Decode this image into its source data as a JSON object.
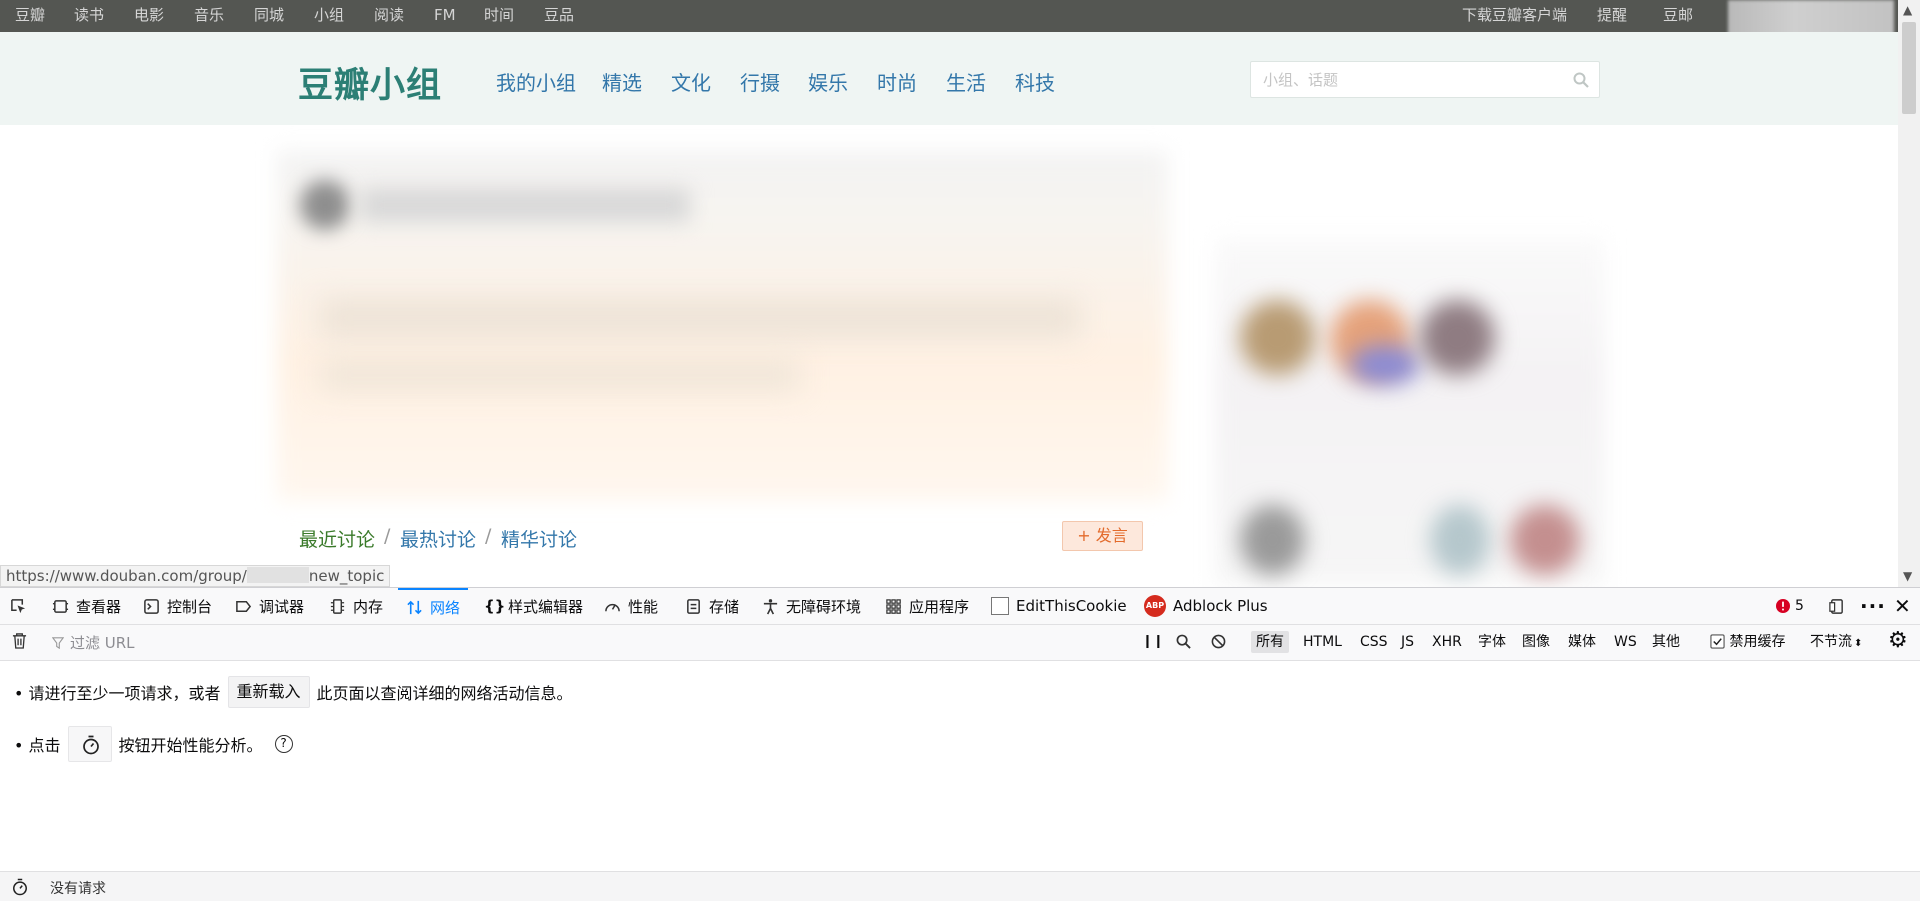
{
  "topnav": {
    "items": [
      "豆瓣",
      "读书",
      "电影",
      "音乐",
      "同城",
      "小组",
      "阅读",
      "FM",
      "时间",
      "豆品"
    ],
    "right": [
      "下载豆瓣客户端",
      "提醒",
      "豆邮"
    ]
  },
  "header": {
    "logo": "豆瓣小组",
    "nav": [
      "我的小组",
      "精选",
      "文化",
      "行摄",
      "娱乐",
      "时尚",
      "生活",
      "科技"
    ],
    "search_placeholder": "小组、话题"
  },
  "discussion_tabs": {
    "items": [
      "最近讨论",
      "最热讨论",
      "精华讨论"
    ],
    "separator": "/",
    "post_button": "+ 发言"
  },
  "status_url": {
    "prefix": "https://www.douban.com/group/",
    "suffix": "new_topic"
  },
  "devtools": {
    "tabs": [
      "查看器",
      "控制台",
      "调试器",
      "内存",
      "网络",
      "样式编辑器",
      "性能",
      "存储",
      "无障碍环境",
      "应用程序",
      "EditThisCookie",
      "Adblock Plus"
    ],
    "active_tab": "网络",
    "error_count": "5",
    "filter_placeholder": "过滤 URL",
    "type_filters": [
      "所有",
      "HTML",
      "CSS",
      "JS",
      "XHR",
      "字体",
      "图像",
      "媒体",
      "WS",
      "其他"
    ],
    "disable_cache": "禁用缓存",
    "throttle": "不节流",
    "empty_msg": {
      "line1_pre": "• 请进行至少一项请求，或者",
      "reload": "重新载入",
      "line1_post": "此页面以查阅详细的网络活动信息。",
      "line2_pre": "• 点击",
      "line2_post": "按钮开始性能分析。"
    },
    "footer_status": "没有请求"
  },
  "colors": {
    "topbar_bg": "#545652",
    "header_bg": "#eff5f3",
    "logo": "#2c7f75",
    "link": "#3377aa",
    "active_tab_link": "#3a7a2a",
    "devtools_accent": "#0a84ff",
    "post_btn_text": "#e36b2c"
  }
}
